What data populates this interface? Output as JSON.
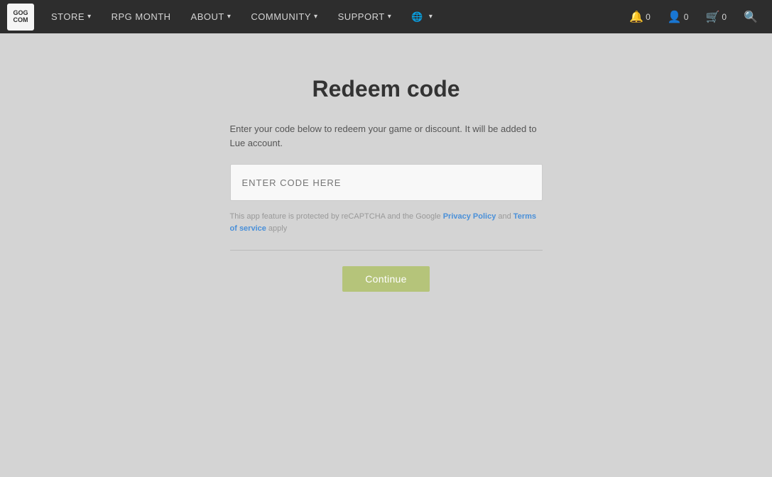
{
  "navbar": {
    "logo_line1": "GOG",
    "logo_line2": "COM",
    "nav_items": [
      {
        "label": "STORE",
        "has_arrow": true
      },
      {
        "label": "RPG MONTH",
        "has_arrow": false
      },
      {
        "label": "ABOUT",
        "has_arrow": true
      },
      {
        "label": "COMMUNITY",
        "has_arrow": true
      },
      {
        "label": "SUPPORT",
        "has_arrow": true
      }
    ],
    "lang_icon_label": "🌐",
    "notifications_count": "0",
    "account_count": "0",
    "cart_count": "0"
  },
  "main": {
    "page_title": "Redeem code",
    "description": "Enter your code below to redeem your game or discount. It will be added to Lue account.",
    "input_placeholder": "ENTER CODE HERE",
    "recaptcha_text_before": "This app feature is protected by reCAPTCHA and the Google ",
    "recaptcha_link_privacy": "Privacy Policy",
    "recaptcha_text_and": " and ",
    "recaptcha_link_terms": "Terms of service",
    "recaptcha_text_after": " apply",
    "continue_button_label": "Continue"
  }
}
